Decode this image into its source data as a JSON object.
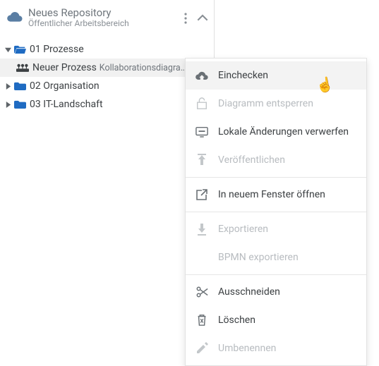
{
  "repo": {
    "title": "Neues Repository",
    "subtitle": "Öffentlicher Arbeitsbereich"
  },
  "tree": {
    "items": [
      {
        "label": "01 Prozesse",
        "expanded": true
      },
      {
        "label": "02 Organisation",
        "expanded": false
      },
      {
        "label": "03 IT-Landschaft",
        "expanded": false
      }
    ],
    "child": {
      "label": "Neuer Prozess",
      "type": "Kollaborationsdiagra…"
    }
  },
  "menu": {
    "checkin": "Einchecken",
    "unlock": "Diagramm entsperren",
    "discard": "Lokale Änderungen verwerfen",
    "publish": "Veröffentlichen",
    "open_window": "In neuem Fenster öffnen",
    "export": "Exportieren",
    "export_bpmn": "BPMN exportieren",
    "cut": "Ausschneiden",
    "delete": "Löschen",
    "rename": "Umbenennen"
  }
}
